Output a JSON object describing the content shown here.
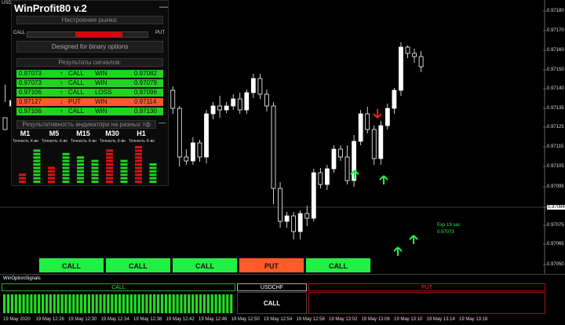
{
  "symbol_short": "USD",
  "panel": {
    "title": "WinProfit80 v.2",
    "minimize_label": "—",
    "mood_label": "Настроение рынка:",
    "call_label": "CALL",
    "put_label": "PUT",
    "mood_put_fraction": 0.39,
    "designed_label": "Designed for binary options",
    "results_label": "Результаты сигналов:",
    "signals": [
      {
        "price": "0.97073",
        "dir": "CALL",
        "arrow": "↑",
        "result": "WIN",
        "close": "0.97082",
        "color": "#22d322"
      },
      {
        "price": "0.97073",
        "dir": "CALL",
        "arrow": "↑",
        "result": "WIN",
        "close": "0.97079",
        "color": "#22d322"
      },
      {
        "price": "0.97106",
        "dir": "CALL",
        "arrow": "↑",
        "result": "LOSS",
        "close": "0.97096",
        "color": "#22d322"
      },
      {
        "price": "0.97127",
        "dir": "PUT",
        "arrow": "↓",
        "result": "WIN",
        "close": "0.97114",
        "color": "#ff5a28"
      },
      {
        "price": "0.97106",
        "dir": "CALL",
        "arrow": "↑",
        "result": "WIN",
        "close": "0.97130",
        "color": "#22d322"
      }
    ],
    "perf_label": "Результативность индикатора на разных тф",
    "perf_minimize": "—",
    "timeframes": [
      {
        "name": "M1",
        "acc": "Точность",
        "cnt": "К-во"
      },
      {
        "name": "M5",
        "acc": "Точность",
        "cnt": "К-во"
      },
      {
        "name": "M15",
        "acc": "Точность",
        "cnt": "К-во"
      },
      {
        "name": "M30",
        "acc": "Точность",
        "cnt": "К-во"
      },
      {
        "name": "H1",
        "acc": "Точность",
        "cnt": "К-во"
      }
    ],
    "perf_bars": [
      {
        "segs": 3,
        "color": "#e01010"
      },
      {
        "segs": 10,
        "color": "#22d322"
      },
      {
        "segs": 5,
        "color": "#e01010"
      },
      {
        "segs": 9,
        "color": "#22d322"
      },
      {
        "segs": 8,
        "color": "#22d322"
      },
      {
        "segs": 7,
        "color": "#22d322"
      },
      {
        "segs": 10,
        "color": "#e01010"
      },
      {
        "segs": 7,
        "color": "#22d322"
      },
      {
        "segs": 11,
        "color": "#e01010"
      },
      {
        "segs": 6,
        "color": "#22d322"
      }
    ]
  },
  "buttons": [
    {
      "label": "CALL",
      "color": "#22ee44"
    },
    {
      "label": "CALL",
      "color": "#22ee44"
    },
    {
      "label": "CALL",
      "color": "#22ee44"
    },
    {
      "label": "PUT",
      "color": "#ff5a28"
    },
    {
      "label": "CALL",
      "color": "#22ee44"
    }
  ],
  "exp_label": "Exp 19 sec",
  "exp_price": "0.97073",
  "current_price": "0.97084",
  "prices": [
    "0.97180",
    "0.97170",
    "0.97160",
    "0.97150",
    "0.97140",
    "0.97135",
    "0.97125",
    "0.97115",
    "0.97105",
    "0.97095",
    "0.97084",
    "0.97075",
    "0.97065",
    "0.97050"
  ],
  "sub": {
    "title": "WinOptionSignals",
    "call_label": "CALL",
    "pair_label": "USDCHF",
    "put_label": "PUT",
    "signal_label": "CALL"
  },
  "times": [
    "19 May 2020",
    "19 May 12:26",
    "19 May 12:30",
    "19 May 12:34",
    "19 May 12:38",
    "19 May 12:42",
    "19 May 12:46",
    "19 May 12:50",
    "19 May 12:54",
    "19 May 12:58",
    "19 May 13:02",
    "19 May 13:06",
    "19 May 13:10",
    "19 May 13:14",
    "19 May 13:18"
  ],
  "candles": [
    [
      200,
      185,
      220,
      242
    ],
    [
      215,
      222,
      210,
      232
    ],
    [
      222,
      235,
      205,
      240
    ],
    [
      232,
      240,
      220,
      248
    ],
    [
      235,
      212,
      208,
      240
    ],
    [
      212,
      182,
      176,
      218
    ],
    [
      182,
      158,
      150,
      190
    ],
    [
      160,
      148,
      142,
      168
    ],
    [
      148,
      130,
      120,
      152
    ],
    [
      130,
      160,
      125,
      168
    ],
    [
      160,
      175,
      150,
      180
    ],
    [
      175,
      138,
      130,
      182
    ],
    [
      140,
      142,
      128,
      148
    ],
    [
      142,
      160,
      134,
      168
    ],
    [
      160,
      190,
      155,
      196
    ],
    [
      190,
      185,
      178,
      200
    ],
    [
      185,
      210,
      180,
      222
    ],
    [
      210,
      244,
      205,
      250
    ],
    [
      244,
      264,
      238,
      270
    ],
    [
      264,
      282,
      255,
      300
    ],
    [
      282,
      300,
      276,
      305
    ],
    [
      300,
      285,
      278,
      315
    ],
    [
      285,
      258,
      244,
      292
    ],
    [
      258,
      230,
      222,
      264
    ],
    [
      230,
      235,
      222,
      240
    ],
    [
      235,
      212,
      205,
      240
    ],
    [
      212,
      150,
      138,
      215
    ],
    [
      150,
      145,
      140,
      160
    ],
    [
      145,
      168,
      140,
      175
    ],
    [
      168,
      150,
      144,
      172
    ],
    [
      150,
      205,
      142,
      210
    ],
    [
      205,
      215,
      198,
      220
    ],
    [
      215,
      210,
      200,
      228
    ],
    [
      210,
      215,
      206,
      220
    ],
    [
      215,
      224,
      210,
      230
    ],
    [
      224,
      210,
      205,
      232
    ],
    [
      210,
      232,
      205,
      236
    ],
    [
      232,
      250,
      225,
      256
    ],
    [
      250,
      230,
      224,
      256
    ],
    [
      230,
      215,
      208,
      236
    ],
    [
      215,
      110,
      90,
      220
    ],
    [
      110,
      68,
      60,
      118
    ],
    [
      68,
      75,
      60,
      80
    ],
    [
      75,
      55,
      45,
      80
    ],
    [
      55,
      78,
      45,
      82
    ],
    [
      78,
      72,
      62,
      88
    ],
    [
      72,
      130,
      68,
      135
    ],
    [
      130,
      115,
      110,
      136
    ],
    [
      115,
      135,
      108,
      140
    ],
    [
      135,
      160,
      130,
      165
    ],
    [
      160,
      150,
      145,
      165
    ],
    [
      150,
      120,
      115,
      165
    ],
    [
      120,
      170,
      112,
      178
    ],
    [
      170,
      205,
      165,
      210
    ],
    [
      205,
      185,
      180,
      214
    ],
    [
      185,
      148,
      140,
      190
    ],
    [
      148,
      190,
      140,
      196
    ],
    [
      190,
      212,
      185,
      218
    ],
    [
      212,
      235,
      205,
      238
    ],
    [
      235,
      290,
      228,
      296
    ],
    [
      290,
      282,
      276,
      292
    ],
    [
      282,
      278,
      270,
      288
    ],
    [
      278,
      265,
      258,
      285
    ]
  ]
}
